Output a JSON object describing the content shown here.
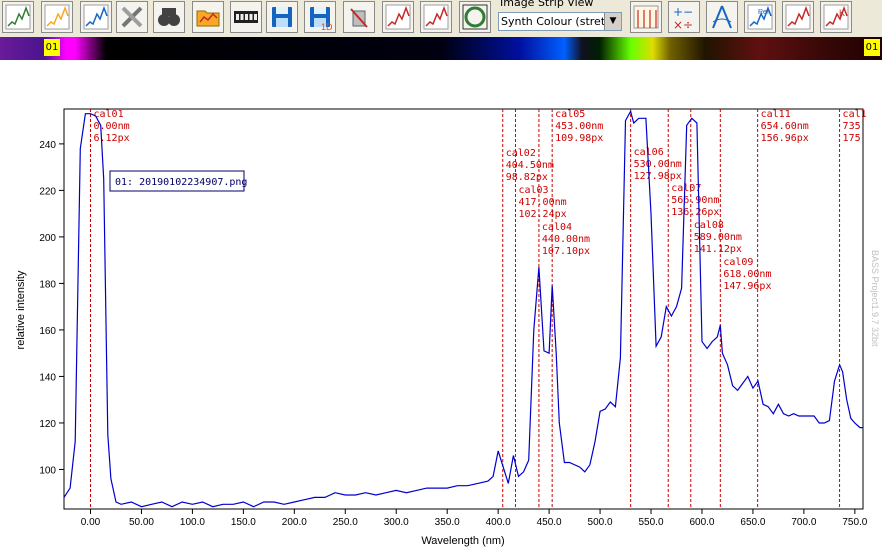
{
  "toolbar": {
    "buttons": [
      {
        "name": "open-image-icon",
        "color": "#2e7d32"
      },
      {
        "name": "load-image-icon",
        "color": "#f9a825"
      },
      {
        "name": "save-image-icon",
        "color": "#1565c0"
      },
      {
        "name": "tools-icon",
        "color": "#757575"
      },
      {
        "name": "binoculars-icon",
        "color": "#424242"
      },
      {
        "name": "folder-graph-icon",
        "color": "#f9a825"
      },
      {
        "name": "camera-strip-icon",
        "color": "#212121"
      },
      {
        "name": "save-disk-icon",
        "color": "#1565c0"
      },
      {
        "name": "save-1d-icon",
        "color": "#1565c0"
      },
      {
        "name": "delete-icon",
        "color": "#c62828"
      },
      {
        "name": "calibrate-icon",
        "color": "#c62828"
      },
      {
        "name": "graph-tool-icon",
        "color": "#c62828"
      },
      {
        "name": "refresh-icon",
        "color": "#2e7d32"
      }
    ],
    "buttons_right": [
      {
        "name": "ruler-icon",
        "color": "#c62828"
      },
      {
        "name": "math-icon",
        "color": "#1565c0"
      },
      {
        "name": "compass-icon",
        "color": "#1565c0"
      },
      {
        "name": "reference-icon",
        "color": "#1565c0"
      },
      {
        "name": "pencil-chart-icon",
        "color": "#c62828"
      },
      {
        "name": "kelvin-chart-icon",
        "color": "#c62828"
      }
    ],
    "strip_view_label": "Image Strip View",
    "strip_view_value": "Synth Colour (stretc"
  },
  "strip": {
    "left_tag": "01",
    "right_tag": "01"
  },
  "chart_data": {
    "type": "line",
    "xlabel": "Wavelength (nm)",
    "ylabel": "relative intensity",
    "xlim": [
      -26,
      758
    ],
    "ylim": [
      83,
      255
    ],
    "xticks": [
      0,
      50,
      100,
      150,
      200,
      250,
      300,
      350,
      400,
      450,
      500,
      550,
      600,
      650,
      700,
      750
    ],
    "xtick_labels": [
      "0.00",
      "50.00",
      "100.0",
      "150.0",
      "200.0",
      "250.0",
      "300.0",
      "350.0",
      "400.0",
      "450.0",
      "500.0",
      "550.0",
      "600.0",
      "650.0",
      "700.0",
      "750.0"
    ],
    "yticks": [
      100,
      120,
      140,
      160,
      180,
      200,
      220,
      240
    ],
    "ytick_labels": [
      "100",
      "120",
      "140",
      "160",
      "180",
      "200",
      "220",
      "240"
    ],
    "series": [
      {
        "name": "01: 20190102234907.png",
        "color": "#0000cc",
        "x": [
          -26,
          -20,
          -15,
          -10,
          -5,
          0,
          5,
          10,
          13,
          17,
          20,
          25,
          30,
          40,
          50,
          60,
          70,
          80,
          90,
          100,
          110,
          120,
          130,
          140,
          150,
          160,
          170,
          180,
          190,
          200,
          210,
          220,
          230,
          240,
          250,
          260,
          270,
          280,
          290,
          300,
          310,
          320,
          330,
          340,
          350,
          360,
          370,
          380,
          390,
          395,
          400,
          405,
          410,
          415,
          420,
          425,
          430,
          435,
          440,
          445,
          450,
          453,
          457,
          460,
          465,
          470,
          480,
          485,
          490,
          495,
          500,
          505,
          510,
          515,
          520,
          525,
          530,
          533,
          538,
          545,
          550,
          555,
          560,
          565,
          570,
          575,
          580,
          585,
          590,
          595,
          600,
          605,
          610,
          615,
          618,
          620,
          625,
          630,
          635,
          640,
          645,
          650,
          655,
          660,
          665,
          670,
          675,
          680,
          685,
          690,
          695,
          700,
          710,
          715,
          720,
          725,
          730,
          735,
          738,
          742,
          746,
          750,
          755,
          758
        ],
        "y": [
          88,
          92,
          112,
          238,
          253,
          253,
          252,
          248,
          225,
          115,
          96,
          86,
          85,
          86,
          84,
          85,
          86,
          84,
          86,
          85,
          86,
          84,
          85,
          85,
          86,
          84,
          86,
          86,
          85,
          86,
          87,
          88,
          88,
          90,
          89,
          89,
          90,
          89,
          90,
          91,
          90,
          91,
          92,
          92,
          92,
          93,
          93,
          94,
          95,
          97,
          108,
          101,
          94,
          106,
          97,
          99,
          104,
          160,
          187,
          151,
          150,
          179,
          150,
          120,
          103,
          103,
          101,
          99,
          102,
          112,
          125,
          126,
          129,
          127,
          148,
          250,
          254,
          249,
          251,
          251,
          210,
          153,
          157,
          170,
          166,
          170,
          178,
          248,
          251,
          249,
          155,
          152,
          155,
          157,
          162,
          150,
          145,
          136,
          134,
          137,
          140,
          135,
          138,
          128,
          127,
          124,
          128,
          124,
          123,
          124,
          123,
          123,
          123,
          120,
          120,
          121,
          138,
          145,
          142,
          130,
          122,
          120,
          118,
          118
        ]
      }
    ],
    "calibration_markers": [
      {
        "label": "cal01",
        "nm": 0.0,
        "nm_text": "0.00nm",
        "px_text": "6.12px"
      },
      {
        "label": "cal02",
        "nm": 404.5,
        "nm_text": "404.50nm",
        "px_text": "98.82px"
      },
      {
        "label": "cal03",
        "nm": 417.0,
        "nm_text": "417.00nm",
        "px_text": "102.24px"
      },
      {
        "label": "cal04",
        "nm": 440.0,
        "nm_text": "440.00nm",
        "px_text": "107.10px"
      },
      {
        "label": "cal05",
        "nm": 453.0,
        "nm_text": "453.00nm",
        "px_text": "109.98px"
      },
      {
        "label": "cal06",
        "nm": 530.0,
        "nm_text": "530.00nm",
        "px_text": "127.98px"
      },
      {
        "label": "cal07",
        "nm": 566.9,
        "nm_text": "566.90nm",
        "px_text": "136.26px"
      },
      {
        "label": "cal08",
        "nm": 589.0,
        "nm_text": "589.00nm",
        "px_text": "141.12px"
      },
      {
        "label": "cal09",
        "nm": 618.0,
        "nm_text": "618.00nm",
        "px_text": "147.96px"
      },
      {
        "label": "cal11",
        "nm": 654.6,
        "nm_text": "654.60nm",
        "px_text": "156.96px"
      },
      {
        "label": "cal1",
        "nm": 735.0,
        "nm_text": "735",
        "px_text": "175"
      }
    ],
    "watermark": "BASS Project1.9.7 32bit",
    "colors": {
      "series": "#0000cc",
      "calibration": "#cc0000"
    }
  }
}
